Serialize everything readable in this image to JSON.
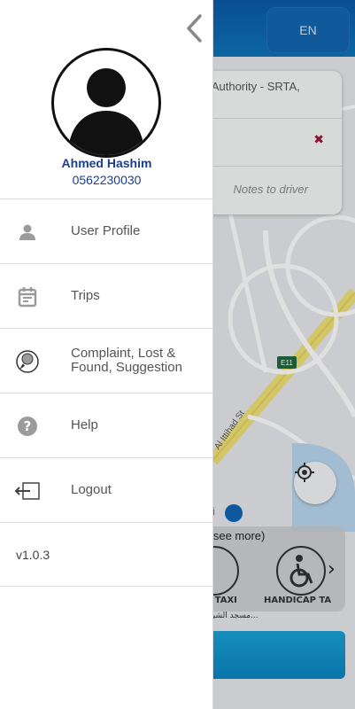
{
  "header": {
    "language_button": "EN"
  },
  "map": {
    "destination_text": "rt Authority - SRTA,",
    "remove_destination_symbol": "✖",
    "notes_placeholder": "Notes to driver",
    "road_shield": "E11",
    "street_label": "Al Ittihad St",
    "poi_label": "ri",
    "see_more": "o see more)",
    "car_options": [
      {
        "label": "S TAXI",
        "icon": "taxi-icon"
      },
      {
        "label": "HANDICAP TA",
        "icon": "wheelchair-icon"
      }
    ],
    "next_symbol": "›",
    "arabic_text": "مسجد الشيخ..."
  },
  "drawer": {
    "back_icon": "chevron-left-icon",
    "user": {
      "name": "Ahmed Hashim",
      "phone": "0562230030"
    },
    "menu": [
      {
        "label": "User Profile",
        "icon": "person-icon"
      },
      {
        "label": "Trips",
        "icon": "calendar-icon"
      },
      {
        "label_line1": "Complaint, Lost &",
        "label_line2": "Found, Suggestion",
        "icon": "complaint-icon"
      },
      {
        "label": "Help",
        "icon": "help-icon"
      },
      {
        "label": "Logout",
        "icon": "logout-icon"
      }
    ],
    "version": "v1.0.3"
  },
  "colors": {
    "accent_blue": "#0e75b8",
    "user_text": "#1a3e8a",
    "icon_gray": "#9b9b9b"
  }
}
